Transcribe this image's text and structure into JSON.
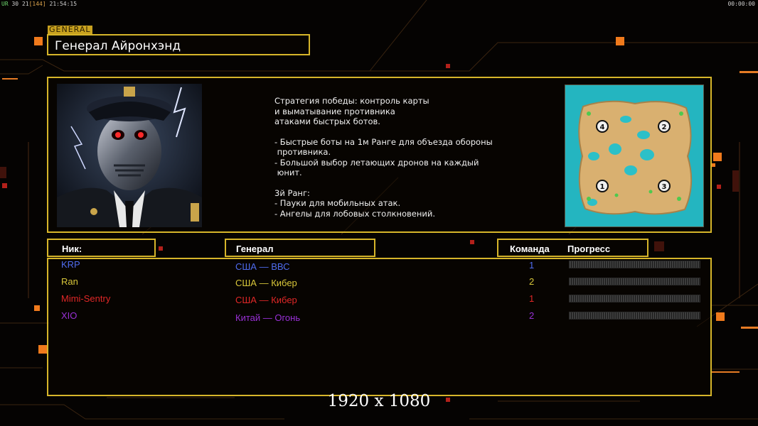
{
  "overlay": {
    "left_stats": {
      "fps_label": "UR",
      "fps": "30",
      "ping": "21",
      "ping_avg": "[144]",
      "clock": "21:54:15"
    },
    "right_timer": "00:00:00"
  },
  "general": {
    "tag": "GENERAL",
    "name": "Генерал Айронхэнд",
    "description": [
      "Стратегия победы: контроль карты",
      "и выматывание противника",
      "атаками быстрых ботов.",
      "",
      "- Быстрые боты на 1м Ранге для объезда обороны",
      " противника.",
      "- Большой выбор летающих дронов на каждый",
      " юнит.",
      "",
      "3й Ранг:",
      "- Пауки для мобильных атак.",
      "- Ангелы для лобовых столкновений."
    ],
    "map_spawns": [
      "1",
      "2",
      "3",
      "4"
    ]
  },
  "table": {
    "headers": {
      "nick": "Ник:",
      "general": "Генерал",
      "team": "Команда",
      "progress": "Прогресс"
    },
    "players": [
      {
        "nick": "KRP",
        "general": "США — ВВС",
        "team": "1",
        "color": "#4f6cf0"
      },
      {
        "nick": "Ran",
        "general": "США — Кибер",
        "team": "2",
        "color": "#d8c63a"
      },
      {
        "nick": "Mimi-Sentry",
        "general": "США — Кибер",
        "team": "1",
        "color": "#e02727"
      },
      {
        "nick": "XIO",
        "general": "Китай — Огонь",
        "team": "2",
        "color": "#9a30d6"
      }
    ]
  },
  "footer": {
    "resolution": "1920 x 1080"
  },
  "colors": {
    "accent_gold": "#d6b52a",
    "orange_square": "#f07a1c",
    "red_square": "#b3201a"
  }
}
